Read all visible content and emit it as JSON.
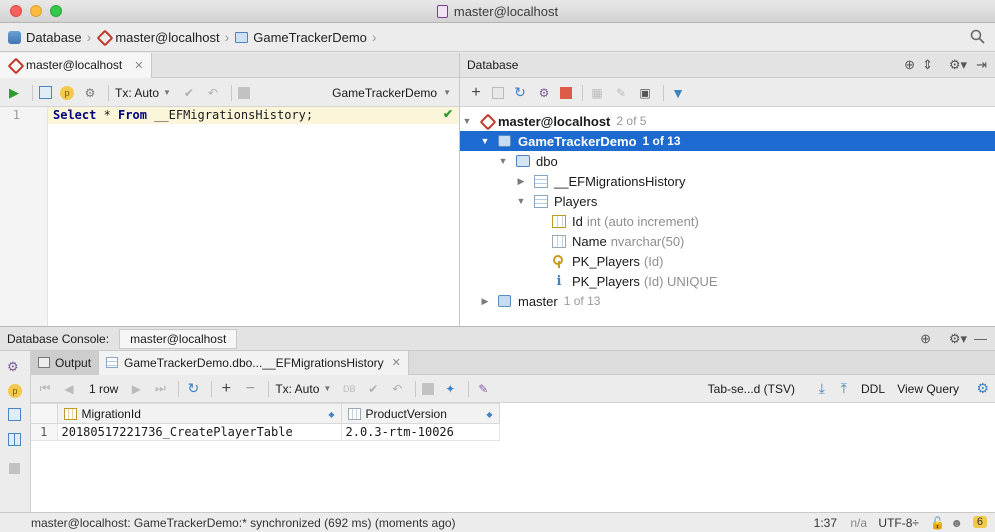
{
  "window": {
    "title": "master@localhost",
    "traffic_colors": [
      "#fc605c",
      "#fdbc40",
      "#34c84a"
    ]
  },
  "navbar": {
    "crumbs": [
      "Database",
      "master@localhost",
      "GameTrackerDemo"
    ]
  },
  "editor": {
    "tab_label": "master@localhost",
    "tx_label": "Tx: Auto",
    "schema_select": "GameTrackerDemo",
    "line_number": "1",
    "code": {
      "kw1": "Select",
      "star": " * ",
      "kw2": "From",
      "table": " __EFMigrationsHistory",
      "end": ";"
    }
  },
  "database_panel": {
    "title": "Database",
    "tree": {
      "root_label": "master@localhost",
      "root_count": "2 of 5",
      "db_label": "GameTrackerDemo",
      "db_count": "1 of 13",
      "schema_label": "dbo",
      "table1": "__EFMigrationsHistory",
      "table2": "Players",
      "col1_name": "Id",
      "col1_type": "int (auto increment)",
      "col2_name": "Name",
      "col2_type": "nvarchar(50)",
      "key_name": "PK_Players",
      "key_cols": "(Id)",
      "index_name": "PK_Players",
      "index_cols": "(Id) UNIQUE",
      "db2_label": "master",
      "db2_count": "1 of 13"
    }
  },
  "console": {
    "header_label": "Database Console:",
    "header_tab": "master@localhost",
    "tabs": [
      "Output",
      "GameTrackerDemo.dbo...__EFMigrationsHistory"
    ],
    "toolbar": {
      "rows": "1 row",
      "tx_label": "Tx: Auto",
      "export_format": "Tab-se...d (TSV)",
      "ddl": "DDL",
      "view_query": "View Query"
    },
    "grid": {
      "columns": [
        "MigrationId",
        "ProductVersion"
      ],
      "rows": [
        {
          "num": "1",
          "cells": [
            "20180517221736_CreatePlayerTable",
            "2.0.3-rtm-10026"
          ]
        }
      ]
    }
  },
  "statusbar": {
    "message": "master@localhost: GameTrackerDemo:* synchronized (692 ms) (moments ago)",
    "position": "1:37",
    "na": "n/a",
    "encoding": "UTF-8÷",
    "badge": "6"
  }
}
